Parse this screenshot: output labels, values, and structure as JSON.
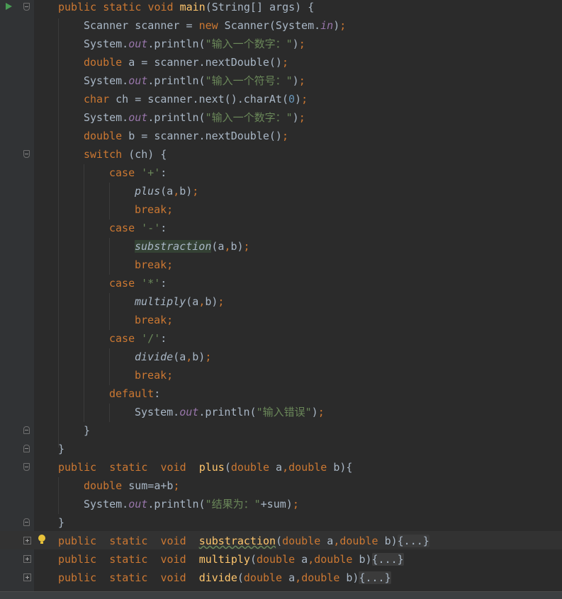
{
  "editor": {
    "language": "java",
    "lines": [
      "public static void main(String[] args) {",
      "Scanner scanner = new Scanner(System.in);",
      "System.out.println(\"输入一个数字：\");",
      "double a = scanner.nextDouble();",
      "System.out.println(\"输入一个符号：\");",
      "char ch = scanner.next().charAt(0);",
      "System.out.println(\"输入一个数字：\");",
      "double b = scanner.nextDouble();",
      "switch (ch) {",
      "case '+':",
      "plus(a,b);",
      "break;",
      "case '-':",
      "substraction(a,b);",
      "break;",
      "case '*':",
      "multiply(a,b);",
      "break;",
      "case '/':",
      "divide(a,b);",
      "break;",
      "default:",
      "System.out.println(\"输入错误\");",
      "}",
      "}",
      "public  static  void  plus(double a,double b){",
      "double sum=a+b;",
      "System.out.println(\"结果为：\"+sum);",
      "}",
      "public  static  void  substraction(double a,double b){...}",
      "public  static  void  multiply(double a,double b){...}",
      "public  static  void  divide(double a,double b){...}"
    ]
  },
  "gutter": {
    "run_icon": "run-triangle-icon",
    "intention_icon": "lightbulb-icon"
  },
  "colors": {
    "background": "#2b2b2b",
    "gutter": "#313335",
    "keyword": "#cc7832",
    "function_decl": "#ffc66d",
    "string": "#6a8759",
    "static_field": "#9876aa",
    "number": "#6897bb",
    "text": "#a9b7c6"
  }
}
